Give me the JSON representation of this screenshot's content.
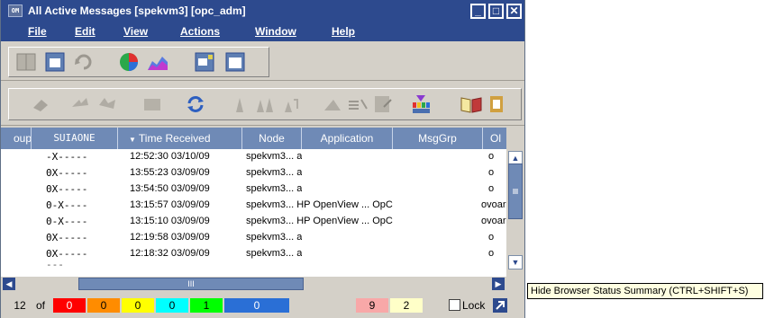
{
  "window": {
    "icon_text": "OM",
    "title": "All Active Messages [spekvm3] [opc_adm]"
  },
  "menu": [
    "File",
    "Edit",
    "View",
    "Actions",
    "Window",
    "Help"
  ],
  "table": {
    "columns": [
      "oup.",
      "SUIAONE",
      "Time Received",
      "Node",
      "Application",
      "MsgGrp",
      "Ol"
    ],
    "rows": [
      {
        "flags": "-X-----",
        "time": "12:52:30 03/10/09",
        "node": "spekvm3... a",
        "application": "",
        "msggrp": "",
        "obj": "o"
      },
      {
        "flags": "0X-----",
        "time": "13:55:23 03/09/09",
        "node": "spekvm3... a",
        "application": "",
        "msggrp": "",
        "obj": "o"
      },
      {
        "flags": "0X-----",
        "time": "13:54:50 03/09/09",
        "node": "spekvm3... a",
        "application": "",
        "msggrp": "",
        "obj": "o"
      },
      {
        "flags": "0-X----",
        "time": "13:15:57 03/09/09",
        "node": "spekvm3... HP OpenView ... OpC",
        "application": "",
        "msggrp": "",
        "obj": "ovoar"
      },
      {
        "flags": "0-X----",
        "time": "13:15:10 03/09/09",
        "node": "spekvm3... HP OpenView ... OpC",
        "application": "",
        "msggrp": "",
        "obj": "ovoar"
      },
      {
        "flags": "0X-----",
        "time": "12:19:58 03/09/09",
        "node": "spekvm3... a",
        "application": "",
        "msggrp": "",
        "obj": "o"
      },
      {
        "flags": "0X-----",
        "time": "12:18:32 03/09/09",
        "node": "spekvm3... a",
        "application": "",
        "msggrp": "",
        "obj": "o"
      }
    ]
  },
  "hscroll_thumb_label": "III",
  "status": {
    "count": "12",
    "of_label": "of",
    "severities": [
      {
        "value": "0",
        "color": "#ff0000"
      },
      {
        "value": "0",
        "color": "#ff8c00"
      },
      {
        "value": "0",
        "color": "#ffff00"
      },
      {
        "value": "0",
        "color": "#00ffff"
      },
      {
        "value": "1",
        "color": "#00ff00"
      },
      {
        "value": "0",
        "color": "#2a6fd6"
      }
    ],
    "unmatched": {
      "value": "9",
      "color": "#f8a8a8"
    },
    "unknown": {
      "value": "2",
      "color": "#ffffc8"
    },
    "lock_label": "Lock"
  },
  "tooltip": "Hide Browser Status Summary (CTRL+SHIFT+S)"
}
